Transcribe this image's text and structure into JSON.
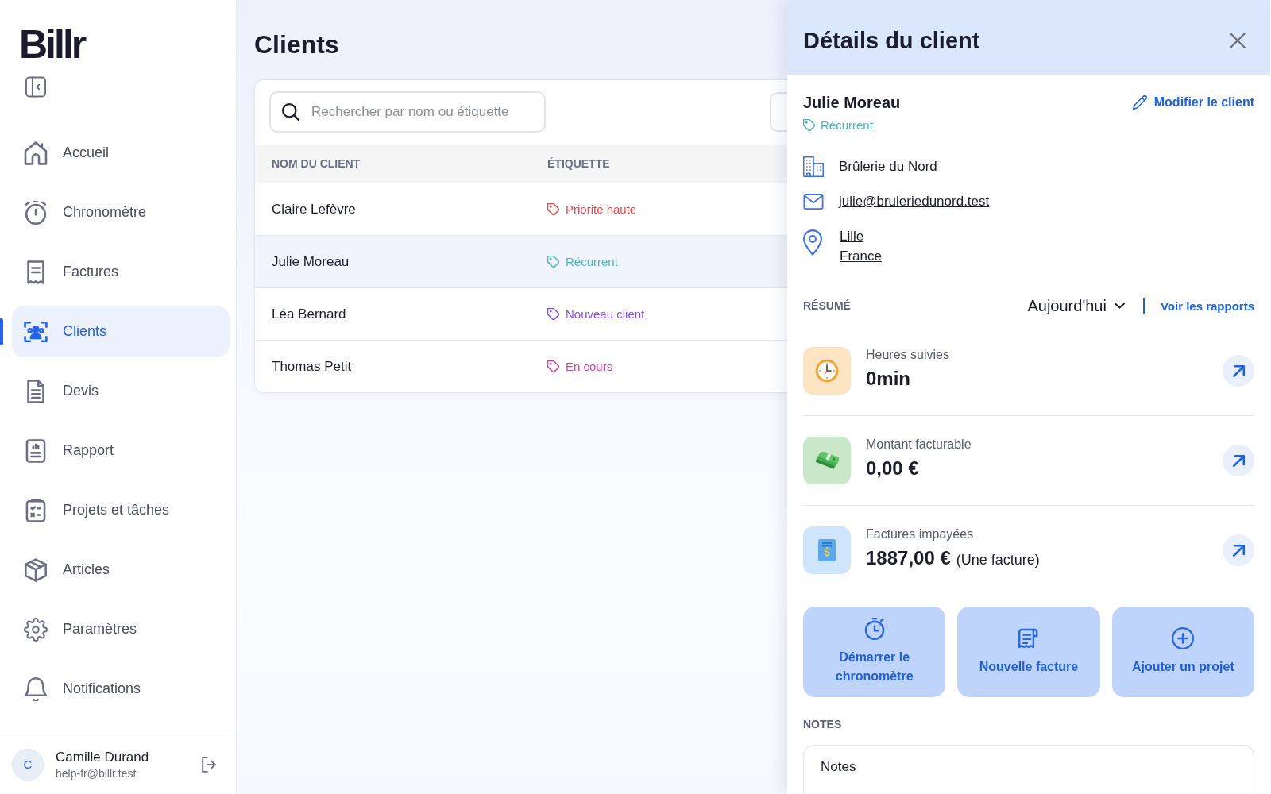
{
  "sidebar": {
    "logo": "Billr",
    "items": [
      {
        "label": "Accueil",
        "selected": false
      },
      {
        "label": "Chronomètre",
        "selected": false
      },
      {
        "label": "Factures",
        "selected": false
      },
      {
        "label": "Clients",
        "selected": true
      },
      {
        "label": "Devis",
        "selected": false
      },
      {
        "label": "Rapport",
        "selected": false
      },
      {
        "label": "Projets et tâches",
        "selected": false
      },
      {
        "label": "Articles",
        "selected": false
      },
      {
        "label": "Paramètres",
        "selected": false
      },
      {
        "label": "Notifications",
        "selected": false
      }
    ],
    "user": {
      "initial": "C",
      "name": "Camille Durand",
      "email": "help-fr@billr.test"
    }
  },
  "page": {
    "title": "Clients"
  },
  "search": {
    "placeholder": "Rechercher par nom ou étiquette"
  },
  "table": {
    "columns": [
      "NOM DU CLIENT",
      "ÉTIQUETTE"
    ],
    "rows": [
      {
        "name": "Claire Lefèvre",
        "tag": "Priorité haute",
        "color": "#e24a4f",
        "selected": false
      },
      {
        "name": "Julie Moreau",
        "tag": "Récurrent",
        "color": "#4db6c2",
        "selected": true
      },
      {
        "name": "Léa Bernard",
        "tag": "Nouveau client",
        "color": "#8b4ee2",
        "selected": false
      },
      {
        "name": "Thomas Petit",
        "tag": "En cours",
        "color": "#d9409f",
        "selected": false
      }
    ]
  },
  "details": {
    "title": "Détails du client",
    "client_name": "Julie Moreau",
    "edit_link": "Modifier le client",
    "tag": {
      "label": "Récurrent",
      "color": "#4db6c2"
    },
    "company": "Brûlerie du Nord",
    "email": "julie@bruleriedunord.test",
    "address": [
      "Lille",
      "France"
    ],
    "summary": {
      "label": "RÉSUMÉ",
      "period": "Aujourd'hui",
      "reports_link": "Voir les rapports"
    },
    "stats": [
      {
        "kind": "time",
        "label": "Heures suivies",
        "value": "0min"
      },
      {
        "kind": "money",
        "label": "Montant facturable",
        "value": "0,00 €"
      },
      {
        "kind": "invoice",
        "label": "Factures impayées",
        "value": "1887,00 €",
        "note": "(Une facture)"
      }
    ],
    "actions": [
      {
        "label": "Démarrer le chronomètre"
      },
      {
        "label": "Nouvelle facture"
      },
      {
        "label": "Ajouter un projet"
      }
    ],
    "notes": {
      "label": "NOTES",
      "value": "Notes"
    }
  }
}
